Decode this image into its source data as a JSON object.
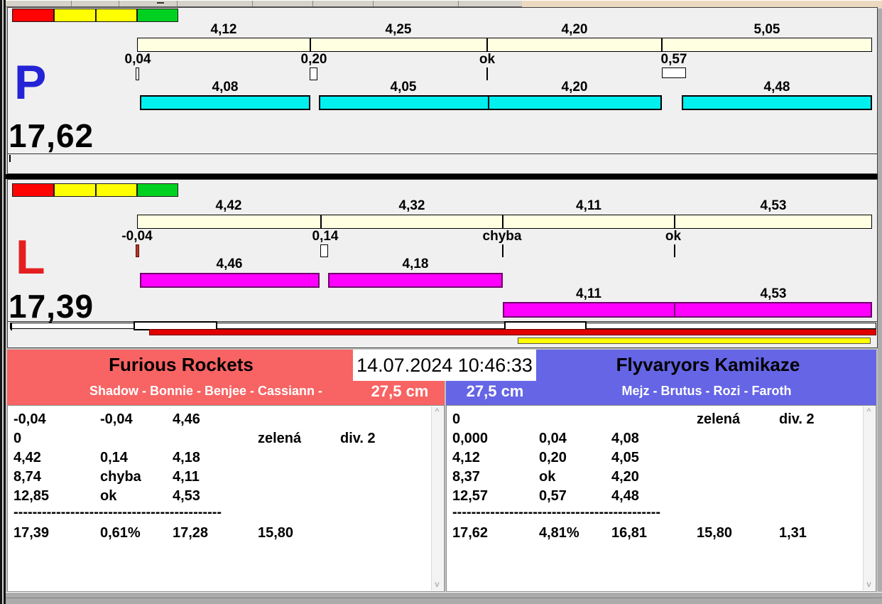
{
  "timestamp": "14.07.2024 10:46:33",
  "colors": {
    "panel_bg": "#F0F0F0",
    "split_bar": "#FFFFE2",
    "lane_p_bar": "#00EFEF",
    "lane_l_bar": "#FF00FF",
    "lane_p_letter": "#2424D6",
    "lane_l_letter": "#E51F1F",
    "team_left_accent": "#F86363",
    "team_right_accent": "#6565E6",
    "status_red": "#FF0202",
    "status_yellow": "#FFFF00",
    "status_green": "#00D120",
    "progress_red": "#E00000",
    "progress_yellow": "#FFFF00"
  },
  "lanes": [
    {
      "letter": "P",
      "total": "17,62",
      "status_lights": [
        "red",
        "yellow",
        "yellow",
        "green"
      ],
      "split_segments": [
        {
          "label": "4,12"
        },
        {
          "label": "4,25"
        },
        {
          "label": "4,20"
        },
        {
          "label": "5,05"
        }
      ],
      "markers": [
        {
          "label": "0,04",
          "type": "fault-box"
        },
        {
          "label": "0,20",
          "type": "fault-box"
        },
        {
          "label": "ok",
          "type": "ok-tick"
        },
        {
          "label": "0,57",
          "type": "fault-box"
        }
      ],
      "time_rows": [
        {
          "segments": [
            {
              "label": "4,08"
            },
            {
              "label": "4,05"
            },
            {
              "label": "4,20"
            },
            {
              "label": "4,48"
            }
          ]
        }
      ]
    },
    {
      "letter": "L",
      "total": "17,39",
      "status_lights": [
        "red",
        "yellow",
        "yellow",
        "green"
      ],
      "split_segments": [
        {
          "label": "4,42"
        },
        {
          "label": "4,32"
        },
        {
          "label": "4,11"
        },
        {
          "label": "4,53"
        }
      ],
      "markers": [
        {
          "label": "-0,04",
          "type": "fault-tick"
        },
        {
          "label": "0,14",
          "type": "fault-box"
        },
        {
          "label": "chyba",
          "type": "error-tick"
        },
        {
          "label": "ok",
          "type": "ok-tick"
        }
      ],
      "time_rows": [
        {
          "segments": [
            {
              "label": "4,46"
            },
            {
              "label": "4,18"
            }
          ]
        },
        {
          "segments": [
            {
              "label": "4,11"
            },
            {
              "label": "4,53"
            }
          ]
        }
      ]
    }
  ],
  "teams": [
    {
      "name": "Furious Rockets",
      "members": "Shadow - Bonnie - Benjee - Cassiann -",
      "distance": "27,5 cm",
      "rows": [
        [
          "-0,04",
          "-0,04",
          "4,46",
          "",
          ""
        ],
        [
          "0",
          "",
          "",
          "zelená",
          "div. 2"
        ],
        [
          "4,42",
          "0,14",
          "4,18",
          "",
          ""
        ],
        [
          "8,74",
          "chyba",
          "4,11",
          "",
          ""
        ],
        [
          "12,85",
          "ok",
          "4,53",
          "",
          ""
        ]
      ],
      "separator": "--------------------------------------------",
      "totals": [
        "17,39",
        "0,61%",
        "17,28",
        "15,80",
        ""
      ]
    },
    {
      "name": "Flyvaryors Kamikaze",
      "members": "Mejz - Brutus - Rozi - Faroth",
      "distance": "27,5 cm",
      "rows": [
        [
          "0",
          "",
          "",
          "zelená",
          "div. 2"
        ],
        [
          "0,000",
          "0,04",
          "4,08",
          "",
          ""
        ],
        [
          "4,12",
          "0,20",
          "4,05",
          "",
          ""
        ],
        [
          "8,37",
          "ok",
          "4,20",
          "",
          ""
        ],
        [
          "12,57",
          "0,57",
          "4,48",
          "",
          ""
        ]
      ],
      "separator": "--------------------------------------------",
      "totals": [
        "17,62",
        "4,81%",
        "16,81",
        "15,80",
        "1,31"
      ]
    }
  ],
  "ui": {
    "scroll_up": "^",
    "scroll_down": "v"
  }
}
